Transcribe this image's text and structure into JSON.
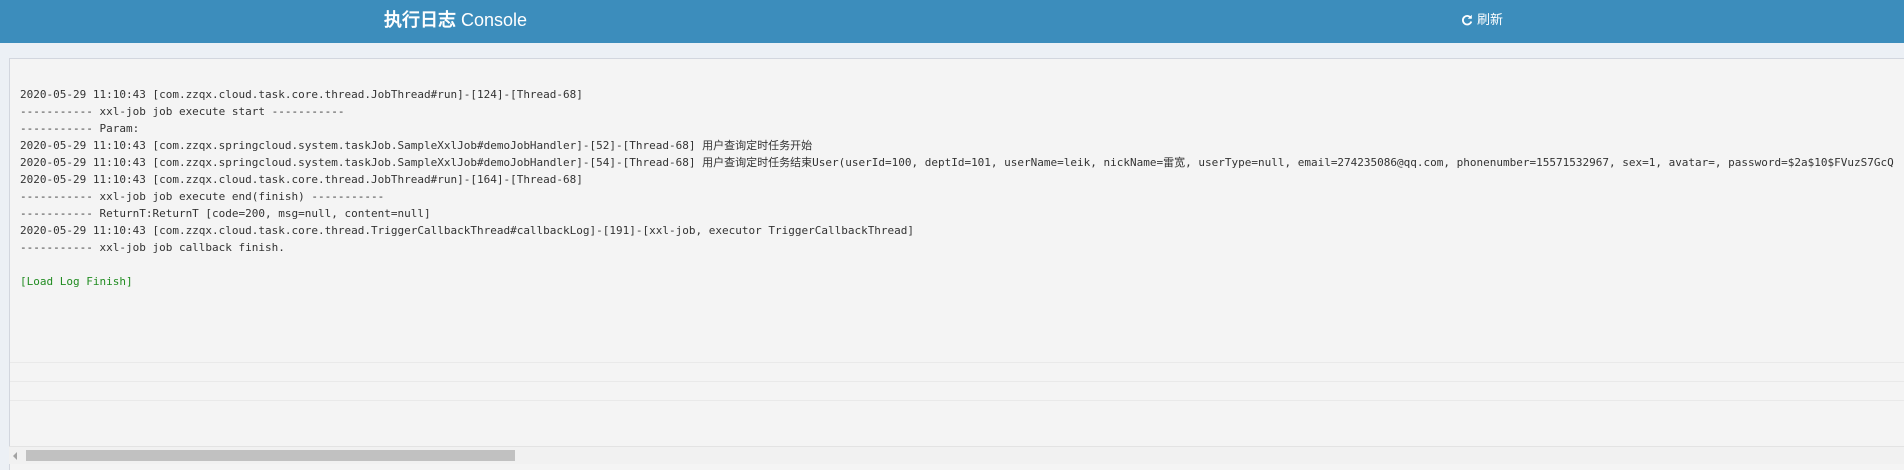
{
  "header": {
    "title_zh": "执行日志",
    "title_en": " Console",
    "refresh_label": "刷新",
    "refresh_icon": "refresh-icon",
    "bg_color": "#3c8dbc"
  },
  "log": {
    "lines": [
      "2020-05-29 11:10:43 [com.zzqx.cloud.task.core.thread.JobThread#run]-[124]-[Thread-68]",
      "----------- xxl-job job execute start -----------",
      "----------- Param:",
      "2020-05-29 11:10:43 [com.zzqx.springcloud.system.taskJob.SampleXxlJob#demoJobHandler]-[52]-[Thread-68] 用户查询定时任务开始",
      "2020-05-29 11:10:43 [com.zzqx.springcloud.system.taskJob.SampleXxlJob#demoJobHandler]-[54]-[Thread-68] 用户查询定时任务结束User(userId=100, deptId=101, userName=leik, nickName=雷宽, userType=null, email=274235086@qq.com, phonenumber=15571532967, sex=1, avatar=, password=$2a$10$FVuzS7GcQ",
      "2020-05-29 11:10:43 [com.zzqx.cloud.task.core.thread.JobThread#run]-[164]-[Thread-68]",
      "----------- xxl-job job execute end(finish) -----------",
      "----------- ReturnT:ReturnT [code=200, msg=null, content=null]",
      "2020-05-29 11:10:43 [com.zzqx.cloud.task.core.thread.TriggerCallbackThread#callbackLog]-[191]-[xxl-job, executor TriggerCallbackThread]",
      "----------- xxl-job job callback finish.",
      ""
    ],
    "finish_text": "[Load Log Finish]",
    "finish_color": "#218c21"
  }
}
